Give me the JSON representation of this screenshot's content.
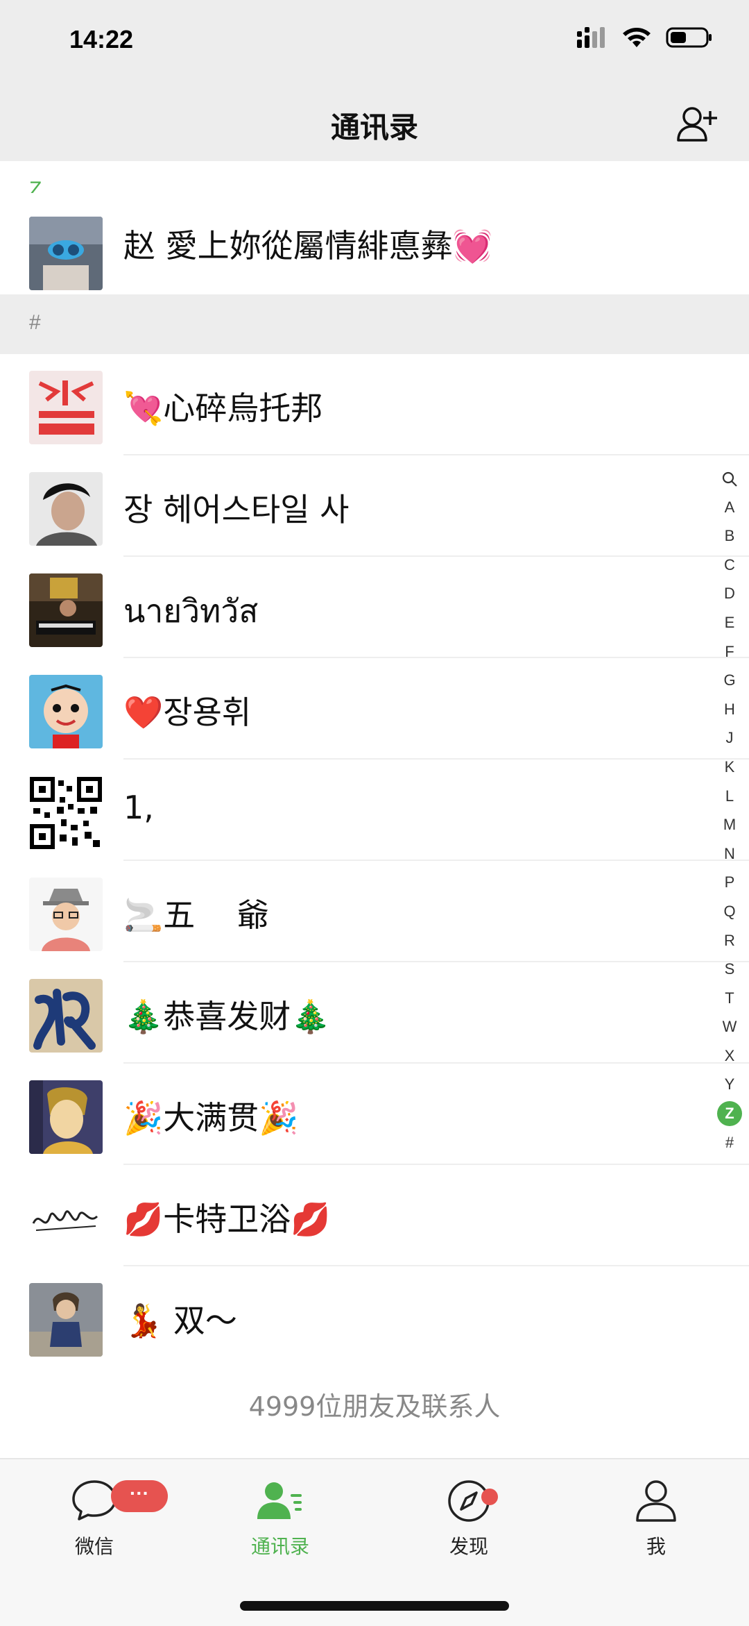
{
  "status_bar": {
    "time": "14:22",
    "icons": [
      "signal-icon",
      "wifi-icon",
      "battery-icon"
    ]
  },
  "nav": {
    "title": "通讯录",
    "right_icon": "add-friend-icon"
  },
  "sections": {
    "z": "Z",
    "hash": "#"
  },
  "contacts_z": [
    {
      "name": "赵 愛上妳從屬情緋悳彝💓",
      "avatar": "profile-photo-mask"
    }
  ],
  "contacts_hash": [
    {
      "name": "💘心碎烏托邦",
      "avatar": "red-text-logo"
    },
    {
      "name": "장 헤어스타일 사",
      "avatar": "portrait-photo"
    },
    {
      "name": "นายวิทวัส",
      "avatar": "music-room-photo"
    },
    {
      "name": "❤️장용휘",
      "avatar": "cartoon-boy"
    },
    {
      "name": "1,",
      "avatar": "qr-code"
    },
    {
      "name": "🚬五　 爺",
      "avatar": "cartoon-man-hat"
    },
    {
      "name": "🎄恭喜发财🎄",
      "avatar": "calligraphy-fo"
    },
    {
      "name": "🎉大满贯🎉",
      "avatar": "selfie-photo"
    },
    {
      "name": "💋卡特卫浴💋",
      "avatar": "signature"
    },
    {
      "name": "💃 双～",
      "avatar": "street-photo"
    }
  ],
  "alpha_index": [
    "search-icon",
    "A",
    "B",
    "C",
    "D",
    "E",
    "F",
    "G",
    "H",
    "J",
    "K",
    "L",
    "M",
    "N",
    "P",
    "Q",
    "R",
    "S",
    "T",
    "W",
    "X",
    "Y",
    "Z",
    "#"
  ],
  "alpha_active": "Z",
  "footer": {
    "count_text": "4999位朋友及联系人"
  },
  "tabs": [
    {
      "label": "微信",
      "icon": "chat-bubble-icon",
      "badge": "···"
    },
    {
      "label": "通讯录",
      "icon": "contacts-icon",
      "active": true
    },
    {
      "label": "发现",
      "icon": "compass-icon",
      "dot": true
    },
    {
      "label": "我",
      "icon": "person-icon"
    }
  ],
  "colors": {
    "accent": "#4fb24f",
    "badge": "#e65350",
    "nav_bg": "#ededed",
    "divider": "#eeeeee"
  }
}
